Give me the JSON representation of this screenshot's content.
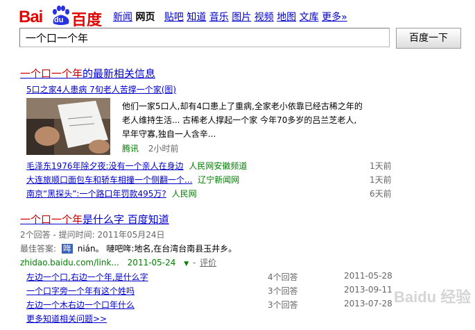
{
  "logo": {
    "text_bai": "Bai",
    "text_du": "du",
    "text_cn": "百度"
  },
  "nav": [
    "新闻",
    "网页",
    "贴吧",
    "知道",
    "音乐",
    "图片",
    "视频",
    "地图",
    "文库",
    "更多»"
  ],
  "search": {
    "query": "一个口一个年",
    "button": "百度一下"
  },
  "news": {
    "title_pre": "一个口一个年",
    "title_post": "的最新相关信息",
    "headline": "5口之家4人患病 7旬老人苦撑一个家(图)",
    "snippet_line1": "他们一家5口人,却有4口患上了重病,全家老小依靠已经古稀之年的",
    "snippet_line2": "老人维持生活... 古稀老人撑起一个家 今年70多岁的吕兰芝老人,",
    "snippet_line3": "早年守寡,独自一人含辛...",
    "source": "腾讯",
    "time": "2小时前",
    "items": [
      {
        "text": "毛泽东1976年除夕夜:没有一个亲人在身边",
        "source": "人民网安徽频道",
        "time": "1天前"
      },
      {
        "text": "大连旅顺口面包车和轿车相撞一个侧翻一个...",
        "source": "辽宁新闻网",
        "time": "1天前"
      },
      {
        "text": "南京“黑探头”:一个路口年罚款495万?",
        "source": "人民网",
        "time": "6天前"
      }
    ]
  },
  "zhidao": {
    "title_a": "一个口一个年",
    "title_b": "是什么字 百度知道",
    "meta": "2个回答 - 提问时间: 2011年05月24日",
    "best_label": "最佳答案:",
    "best_char": "哖",
    "best_text": "nián。 嗹吧哖:地名,在台湾台南县玉井乡。",
    "url": "zhidao.baidu.com/link...",
    "url_date": "2011-05-24",
    "rate": "评价",
    "items": [
      {
        "text": "左边一个口,右边一个年,是什么字",
        "count": "4个回答",
        "date": "2011-05-28"
      },
      {
        "text": "一个口字旁一个年有这个姓吗",
        "count": "3个回答",
        "date": "2013-09-11"
      },
      {
        "text": "左边一个木右边一个口年什么",
        "count": "3个回答",
        "date": "2013-07-28"
      }
    ],
    "more": "更多知道相关问题>>"
  },
  "watermark": "Baidu 经验",
  "colors": {
    "brand": "#e10602",
    "link": "#0000cc",
    "highlight": "#cc0000",
    "source": "#008000"
  }
}
